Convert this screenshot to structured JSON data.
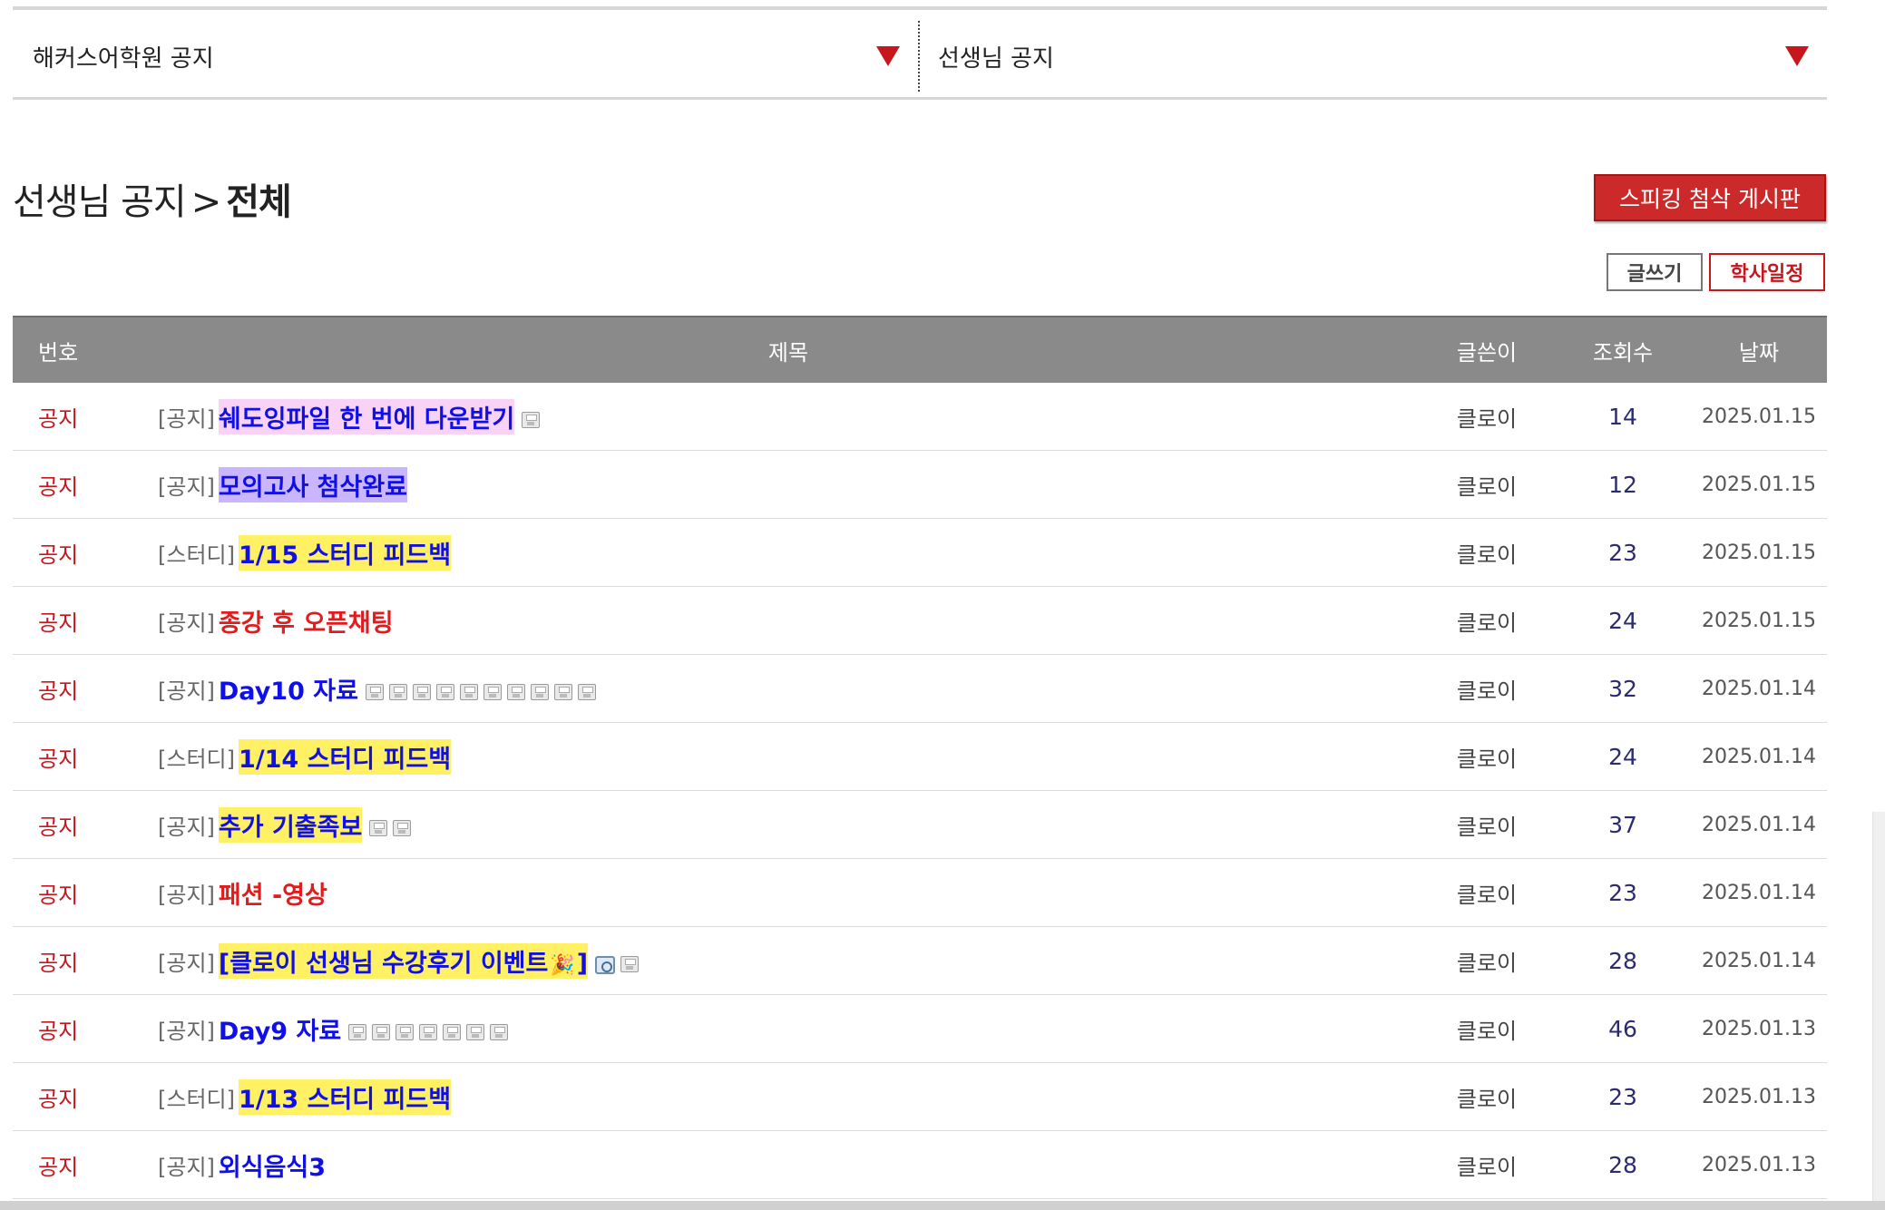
{
  "selector": {
    "left_label": "해커스어학원 공지",
    "right_label": "선생님 공지"
  },
  "heading": {
    "parent": "선생님 공지",
    "separator": ">",
    "current": "전체"
  },
  "buttons": {
    "speaking": "스피킹 첨삭 게시판",
    "write": "글쓰기",
    "schedule": "학사일정"
  },
  "table": {
    "headers": {
      "num": "번호",
      "title": "제목",
      "writer": "글쓴이",
      "views": "조회수",
      "date": "날짜"
    },
    "rows": [
      {
        "num": "공지",
        "cat": "[공지]",
        "subject": "쉐도잉파일 한 번에 다운받기",
        "writer": "클로이",
        "views": "14",
        "date": "2025.01.15"
      },
      {
        "num": "공지",
        "cat": "[공지]",
        "subject": "모의고사 첨삭완료",
        "writer": "클로이",
        "views": "12",
        "date": "2025.01.15"
      },
      {
        "num": "공지",
        "cat": "[스터디]",
        "subject": "1/15 스터디 피드백",
        "writer": "클로이",
        "views": "23",
        "date": "2025.01.15"
      },
      {
        "num": "공지",
        "cat": "[공지]",
        "subject": "종강 후 오픈채팅",
        "writer": "클로이",
        "views": "24",
        "date": "2025.01.15"
      },
      {
        "num": "공지",
        "cat": "[공지]",
        "subject": "Day10 자료",
        "writer": "클로이",
        "views": "32",
        "date": "2025.01.14"
      },
      {
        "num": "공지",
        "cat": "[스터디]",
        "subject": "1/14 스터디 피드백",
        "writer": "클로이",
        "views": "24",
        "date": "2025.01.14"
      },
      {
        "num": "공지",
        "cat": "[공지]",
        "subject": "추가 기출족보",
        "writer": "클로이",
        "views": "37",
        "date": "2025.01.14"
      },
      {
        "num": "공지",
        "cat": "[공지]",
        "subject": "패션 -영상",
        "writer": "클로이",
        "views": "23",
        "date": "2025.01.14"
      },
      {
        "num": "공지",
        "cat": "[공지]",
        "subject": "[클로이 선생님 수강후기 이벤트",
        "subject_end": "]",
        "writer": "클로이",
        "views": "28",
        "date": "2025.01.14"
      },
      {
        "num": "공지",
        "cat": "[공지]",
        "subject": "Day9 자료",
        "writer": "클로이",
        "views": "46",
        "date": "2025.01.13"
      },
      {
        "num": "공지",
        "cat": "[스터디]",
        "subject": "1/13 스터디 피드백",
        "writer": "클로이",
        "views": "23",
        "date": "2025.01.13"
      },
      {
        "num": "공지",
        "cat": "[공지]",
        "subject": "외식음식3",
        "writer": "클로이",
        "views": "28",
        "date": "2025.01.13"
      }
    ]
  },
  "icons": {
    "dropdown": "triangle-down-icon",
    "attachment": "floppy-disk-icon",
    "image": "image-icon",
    "party": "party-popper-icon"
  },
  "colors": {
    "accent_red": "#c8161d",
    "header_gray": "#8a8a8a",
    "subject_blue": "#1010e6",
    "subject_red": "#e21c1c",
    "highlight_yellow": "#fff163",
    "highlight_pink": "#f9d3f6",
    "highlight_purple": "#c9b6ff"
  }
}
